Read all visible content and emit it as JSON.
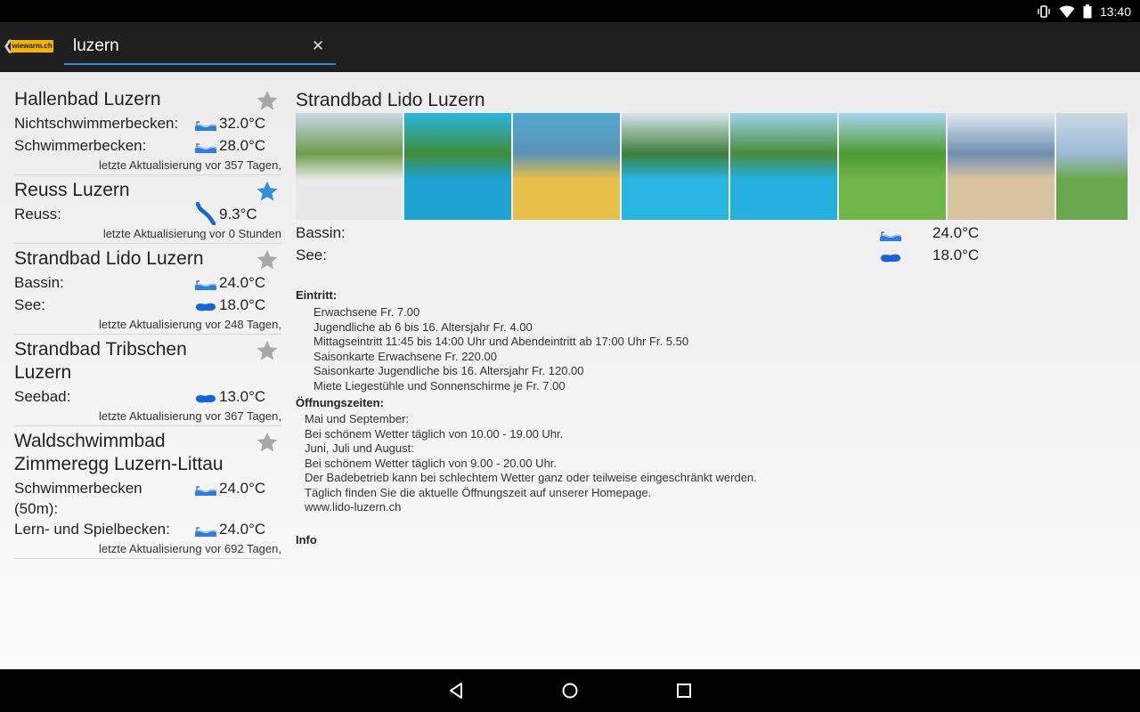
{
  "status_bar": {
    "time": "13:40",
    "icons": [
      "vibrate-icon",
      "wifi-icon",
      "battery-icon"
    ]
  },
  "app_bar": {
    "logo_text": "wiewarm.ch",
    "search": {
      "value": "luzern",
      "placeholder": ""
    }
  },
  "results": [
    {
      "title": "Hallenbad Luzern",
      "favorite": false,
      "rows": [
        {
          "label": "Nichtschwimmerbecken:",
          "icon": "pool-icon",
          "value": "32.0°C"
        },
        {
          "label": "Schwimmerbecken:",
          "icon": "pool-icon",
          "value": "28.0°C"
        }
      ],
      "updated": "letzte Aktualisierung vor 357 Tagen,"
    },
    {
      "title": "Reuss Luzern",
      "favorite": true,
      "rows": [
        {
          "label": "Reuss:",
          "icon": "river-icon",
          "value": "9.3°C"
        }
      ],
      "updated": "letzte Aktualisierung vor 0 Stunden"
    },
    {
      "title": "Strandbad Lido Luzern",
      "favorite": false,
      "rows": [
        {
          "label": "Bassin:",
          "icon": "pool-icon",
          "value": "24.0°C"
        },
        {
          "label": "See:",
          "icon": "lake-icon",
          "value": "18.0°C"
        }
      ],
      "updated": "letzte Aktualisierung vor 248 Tagen,"
    },
    {
      "title": "Strandbad Tribschen Luzern",
      "favorite": false,
      "rows": [
        {
          "label": "Seebad:",
          "icon": "lake-icon",
          "value": "13.0°C"
        }
      ],
      "updated": "letzte Aktualisierung vor 367 Tagen,"
    },
    {
      "title": "Waldschwimmbad Zimmeregg Luzern-Littau",
      "favorite": false,
      "rows": [
        {
          "label": "Schwimmerbecken (50m):",
          "icon": "pool-icon",
          "value": "24.0°C"
        },
        {
          "label": "Lern- und Spielbecken:",
          "icon": "pool-icon",
          "value": "24.0°C"
        }
      ],
      "updated": "letzte Aktualisierung vor 692 Tagen,"
    }
  ],
  "detail": {
    "title": "Strandbad Lido Luzern",
    "photo_count": 8,
    "temps": [
      {
        "label": "Bassin:",
        "icon": "pool-icon",
        "value": "24.0°C"
      },
      {
        "label": "See:",
        "icon": "lake-icon",
        "value": "18.0°C"
      }
    ],
    "eintritt_heading": "Eintritt:",
    "eintritt_lines": [
      "Erwachsene Fr. 7.00",
      "Jugendliche ab 6 bis 16. Altersjahr Fr. 4.00",
      "Mittagseintritt 11:45 bis 14:00 Uhr und Abendeintritt ab 17:00 Uhr Fr. 5.50",
      "Saisonkarte Erwachsene Fr. 220.00",
      "Saisonkarte Jugendliche bis 16. Altersjahr Fr. 120.00",
      "Miete Liegestühle und Sonnenschirme je Fr. 7.00"
    ],
    "oeffnung_heading": "Öffnungszeiten:",
    "oeffnung_lines": [
      "Mai und September:",
      "Bei schönem Wetter täglich von 10.00 - 19.00 Uhr.",
      "Juni, Juli und August:",
      "Bei schönem Wetter täglich von 9.00 - 20.00 Uhr.",
      "Der Badebetrieb kann bei schlechtem Wetter ganz oder teilweise eingeschränkt werden.",
      "Täglich finden Sie die aktuelle Öffnungszeit auf unserer Homepage.",
      "www.lido-luzern.ch"
    ],
    "info_heading": "Info"
  },
  "nav_bar": {
    "buttons": [
      "back-icon",
      "home-icon",
      "recents-icon"
    ]
  },
  "colors": {
    "accent": "#2f8fd8",
    "favorite": "#2f8fd8",
    "star_off": "#a8a8a8",
    "water": "#1565d8",
    "logo": "#f5b400"
  }
}
